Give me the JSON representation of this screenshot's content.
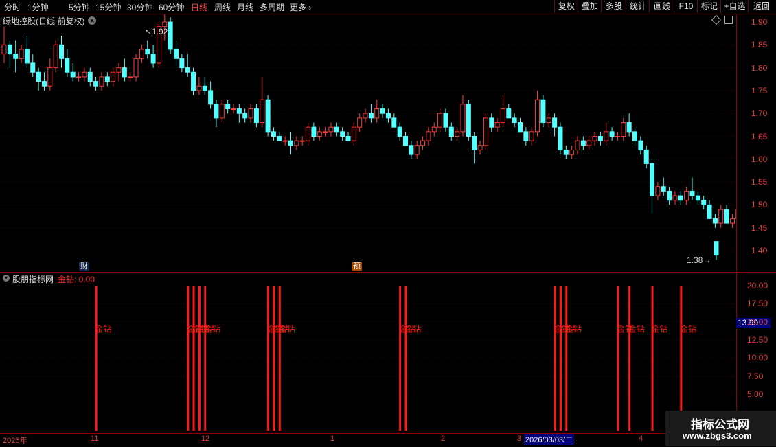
{
  "toolbar": {
    "periods": [
      "分时",
      "1分钟",
      "5分钟",
      "15分钟",
      "30分钟",
      "60分钟",
      "日线",
      "周线",
      "月线",
      "多周期",
      "更多"
    ],
    "active_period": "日线",
    "buttons": [
      "复权",
      "叠加",
      "多股",
      "统计",
      "画线",
      "F10",
      "标记",
      "+自选",
      "返回"
    ]
  },
  "main": {
    "title": "绿地控股(日线 前复权)",
    "high_label": "1.92",
    "low_label": "1.38",
    "badge_cai": "财",
    "badge_yu": "预",
    "yaxis": [
      "1.90",
      "1.85",
      "1.80",
      "1.75",
      "1.70",
      "1.65",
      "1.60",
      "1.55",
      "1.50",
      "1.45",
      "1.40"
    ]
  },
  "indicator": {
    "title": "股朋指标网",
    "series_label": "金钻: 0.00",
    "bar_label": "金钻",
    "current_value": "13.99",
    "yaxis": [
      "20.00",
      "17.50",
      "15.00",
      "12.50",
      "10.00",
      "7.50",
      "5.00"
    ],
    "signal_bar_value": 20
  },
  "dates": {
    "labels": [
      "2025年",
      "11",
      "12",
      "1",
      "2",
      "3",
      "2026/03/03/二",
      "4"
    ]
  },
  "watermark": {
    "line1": "指标公式网",
    "line2": "www.zbgs3.com"
  },
  "colors": {
    "up": "#ff3c3c",
    "down": "#54ffff",
    "axis": "#8b0000",
    "signal": "#ff1a1a",
    "highlight": "#00007a"
  },
  "chart_data": {
    "type": "candlestick",
    "ylim": [
      1.38,
      1.93
    ],
    "candles": [
      {
        "o": 1.83,
        "h": 1.89,
        "l": 1.81,
        "c": 1.85
      },
      {
        "o": 1.85,
        "h": 1.86,
        "l": 1.8,
        "c": 1.83
      },
      {
        "o": 1.83,
        "h": 1.86,
        "l": 1.79,
        "c": 1.82
      },
      {
        "o": 1.82,
        "h": 1.85,
        "l": 1.81,
        "c": 1.84
      },
      {
        "o": 1.84,
        "h": 1.87,
        "l": 1.8,
        "c": 1.81
      },
      {
        "o": 1.81,
        "h": 1.83,
        "l": 1.78,
        "c": 1.79
      },
      {
        "o": 1.79,
        "h": 1.8,
        "l": 1.75,
        "c": 1.77
      },
      {
        "o": 1.77,
        "h": 1.79,
        "l": 1.75,
        "c": 1.76
      },
      {
        "o": 1.76,
        "h": 1.82,
        "l": 1.75,
        "c": 1.8
      },
      {
        "o": 1.8,
        "h": 1.86,
        "l": 1.79,
        "c": 1.85
      },
      {
        "o": 1.85,
        "h": 1.87,
        "l": 1.8,
        "c": 1.82
      },
      {
        "o": 1.82,
        "h": 1.84,
        "l": 1.78,
        "c": 1.79
      },
      {
        "o": 1.79,
        "h": 1.81,
        "l": 1.77,
        "c": 1.78
      },
      {
        "o": 1.78,
        "h": 1.79,
        "l": 1.77,
        "c": 1.78
      },
      {
        "o": 1.78,
        "h": 1.8,
        "l": 1.77,
        "c": 1.79
      },
      {
        "o": 1.79,
        "h": 1.8,
        "l": 1.76,
        "c": 1.77
      },
      {
        "o": 1.77,
        "h": 1.78,
        "l": 1.75,
        "c": 1.76
      },
      {
        "o": 1.76,
        "h": 1.79,
        "l": 1.75,
        "c": 1.78
      },
      {
        "o": 1.78,
        "h": 1.79,
        "l": 1.76,
        "c": 1.77
      },
      {
        "o": 1.77,
        "h": 1.8,
        "l": 1.76,
        "c": 1.79
      },
      {
        "o": 1.79,
        "h": 1.81,
        "l": 1.77,
        "c": 1.8
      },
      {
        "o": 1.8,
        "h": 1.82,
        "l": 1.77,
        "c": 1.78
      },
      {
        "o": 1.78,
        "h": 1.79,
        "l": 1.77,
        "c": 1.78
      },
      {
        "o": 1.78,
        "h": 1.83,
        "l": 1.77,
        "c": 1.82
      },
      {
        "o": 1.82,
        "h": 1.85,
        "l": 1.81,
        "c": 1.84
      },
      {
        "o": 1.84,
        "h": 1.86,
        "l": 1.82,
        "c": 1.83
      },
      {
        "o": 1.83,
        "h": 1.85,
        "l": 1.8,
        "c": 1.81
      },
      {
        "o": 1.81,
        "h": 1.9,
        "l": 1.8,
        "c": 1.89
      },
      {
        "o": 1.89,
        "h": 1.92,
        "l": 1.86,
        "c": 1.9
      },
      {
        "o": 1.9,
        "h": 1.91,
        "l": 1.83,
        "c": 1.84
      },
      {
        "o": 1.84,
        "h": 1.86,
        "l": 1.8,
        "c": 1.82
      },
      {
        "o": 1.82,
        "h": 1.83,
        "l": 1.79,
        "c": 1.8
      },
      {
        "o": 1.8,
        "h": 1.83,
        "l": 1.78,
        "c": 1.79
      },
      {
        "o": 1.79,
        "h": 1.8,
        "l": 1.74,
        "c": 1.75
      },
      {
        "o": 1.75,
        "h": 1.78,
        "l": 1.74,
        "c": 1.76
      },
      {
        "o": 1.76,
        "h": 1.78,
        "l": 1.74,
        "c": 1.75
      },
      {
        "o": 1.75,
        "h": 1.77,
        "l": 1.71,
        "c": 1.72
      },
      {
        "o": 1.72,
        "h": 1.73,
        "l": 1.67,
        "c": 1.69
      },
      {
        "o": 1.69,
        "h": 1.73,
        "l": 1.68,
        "c": 1.72
      },
      {
        "o": 1.72,
        "h": 1.73,
        "l": 1.7,
        "c": 1.71
      },
      {
        "o": 1.71,
        "h": 1.72,
        "l": 1.7,
        "c": 1.71
      },
      {
        "o": 1.71,
        "h": 1.72,
        "l": 1.68,
        "c": 1.7
      },
      {
        "o": 1.7,
        "h": 1.71,
        "l": 1.68,
        "c": 1.69
      },
      {
        "o": 1.69,
        "h": 1.72,
        "l": 1.68,
        "c": 1.71
      },
      {
        "o": 1.71,
        "h": 1.72,
        "l": 1.67,
        "c": 1.68
      },
      {
        "o": 1.68,
        "h": 1.78,
        "l": 1.67,
        "c": 1.73
      },
      {
        "o": 1.73,
        "h": 1.74,
        "l": 1.65,
        "c": 1.66
      },
      {
        "o": 1.66,
        "h": 1.67,
        "l": 1.64,
        "c": 1.65
      },
      {
        "o": 1.65,
        "h": 1.66,
        "l": 1.64,
        "c": 1.64
      },
      {
        "o": 1.64,
        "h": 1.65,
        "l": 1.63,
        "c": 1.64
      },
      {
        "o": 1.64,
        "h": 1.66,
        "l": 1.61,
        "c": 1.63
      },
      {
        "o": 1.63,
        "h": 1.65,
        "l": 1.62,
        "c": 1.64
      },
      {
        "o": 1.64,
        "h": 1.65,
        "l": 1.63,
        "c": 1.64
      },
      {
        "o": 1.64,
        "h": 1.68,
        "l": 1.63,
        "c": 1.67
      },
      {
        "o": 1.67,
        "h": 1.68,
        "l": 1.64,
        "c": 1.65
      },
      {
        "o": 1.65,
        "h": 1.67,
        "l": 1.64,
        "c": 1.66
      },
      {
        "o": 1.66,
        "h": 1.67,
        "l": 1.65,
        "c": 1.66
      },
      {
        "o": 1.66,
        "h": 1.68,
        "l": 1.65,
        "c": 1.67
      },
      {
        "o": 1.67,
        "h": 1.68,
        "l": 1.65,
        "c": 1.66
      },
      {
        "o": 1.66,
        "h": 1.67,
        "l": 1.64,
        "c": 1.65
      },
      {
        "o": 1.65,
        "h": 1.66,
        "l": 1.64,
        "c": 1.64
      },
      {
        "o": 1.64,
        "h": 1.68,
        "l": 1.63,
        "c": 1.67
      },
      {
        "o": 1.67,
        "h": 1.7,
        "l": 1.66,
        "c": 1.69
      },
      {
        "o": 1.69,
        "h": 1.71,
        "l": 1.68,
        "c": 1.7
      },
      {
        "o": 1.7,
        "h": 1.72,
        "l": 1.68,
        "c": 1.69
      },
      {
        "o": 1.69,
        "h": 1.73,
        "l": 1.68,
        "c": 1.71
      },
      {
        "o": 1.71,
        "h": 1.72,
        "l": 1.69,
        "c": 1.7
      },
      {
        "o": 1.7,
        "h": 1.71,
        "l": 1.68,
        "c": 1.69
      },
      {
        "o": 1.69,
        "h": 1.7,
        "l": 1.67,
        "c": 1.67
      },
      {
        "o": 1.67,
        "h": 1.68,
        "l": 1.64,
        "c": 1.65
      },
      {
        "o": 1.65,
        "h": 1.66,
        "l": 1.63,
        "c": 1.63
      },
      {
        "o": 1.63,
        "h": 1.64,
        "l": 1.6,
        "c": 1.61
      },
      {
        "o": 1.61,
        "h": 1.64,
        "l": 1.6,
        "c": 1.63
      },
      {
        "o": 1.63,
        "h": 1.65,
        "l": 1.62,
        "c": 1.64
      },
      {
        "o": 1.64,
        "h": 1.67,
        "l": 1.63,
        "c": 1.66
      },
      {
        "o": 1.66,
        "h": 1.68,
        "l": 1.65,
        "c": 1.67
      },
      {
        "o": 1.67,
        "h": 1.71,
        "l": 1.66,
        "c": 1.7
      },
      {
        "o": 1.7,
        "h": 1.71,
        "l": 1.66,
        "c": 1.67
      },
      {
        "o": 1.67,
        "h": 1.68,
        "l": 1.64,
        "c": 1.65
      },
      {
        "o": 1.65,
        "h": 1.67,
        "l": 1.64,
        "c": 1.66
      },
      {
        "o": 1.66,
        "h": 1.74,
        "l": 1.65,
        "c": 1.72
      },
      {
        "o": 1.72,
        "h": 1.73,
        "l": 1.64,
        "c": 1.65
      },
      {
        "o": 1.65,
        "h": 1.66,
        "l": 1.59,
        "c": 1.62
      },
      {
        "o": 1.62,
        "h": 1.64,
        "l": 1.61,
        "c": 1.63
      },
      {
        "o": 1.63,
        "h": 1.7,
        "l": 1.62,
        "c": 1.69
      },
      {
        "o": 1.69,
        "h": 1.7,
        "l": 1.66,
        "c": 1.67
      },
      {
        "o": 1.67,
        "h": 1.69,
        "l": 1.66,
        "c": 1.68
      },
      {
        "o": 1.68,
        "h": 1.74,
        "l": 1.67,
        "c": 1.71
      },
      {
        "o": 1.71,
        "h": 1.72,
        "l": 1.69,
        "c": 1.69
      },
      {
        "o": 1.69,
        "h": 1.7,
        "l": 1.67,
        "c": 1.68
      },
      {
        "o": 1.68,
        "h": 1.69,
        "l": 1.66,
        "c": 1.66
      },
      {
        "o": 1.66,
        "h": 1.67,
        "l": 1.63,
        "c": 1.64
      },
      {
        "o": 1.64,
        "h": 1.67,
        "l": 1.63,
        "c": 1.66
      },
      {
        "o": 1.66,
        "h": 1.75,
        "l": 1.65,
        "c": 1.73
      },
      {
        "o": 1.73,
        "h": 1.74,
        "l": 1.67,
        "c": 1.68
      },
      {
        "o": 1.68,
        "h": 1.7,
        "l": 1.67,
        "c": 1.69
      },
      {
        "o": 1.69,
        "h": 1.7,
        "l": 1.65,
        "c": 1.67
      },
      {
        "o": 1.67,
        "h": 1.68,
        "l": 1.61,
        "c": 1.62
      },
      {
        "o": 1.62,
        "h": 1.63,
        "l": 1.6,
        "c": 1.61
      },
      {
        "o": 1.61,
        "h": 1.63,
        "l": 1.6,
        "c": 1.62
      },
      {
        "o": 1.62,
        "h": 1.65,
        "l": 1.61,
        "c": 1.64
      },
      {
        "o": 1.64,
        "h": 1.65,
        "l": 1.62,
        "c": 1.63
      },
      {
        "o": 1.63,
        "h": 1.65,
        "l": 1.62,
        "c": 1.64
      },
      {
        "o": 1.64,
        "h": 1.66,
        "l": 1.63,
        "c": 1.65
      },
      {
        "o": 1.65,
        "h": 1.66,
        "l": 1.63,
        "c": 1.64
      },
      {
        "o": 1.64,
        "h": 1.68,
        "l": 1.63,
        "c": 1.66
      },
      {
        "o": 1.66,
        "h": 1.67,
        "l": 1.64,
        "c": 1.65
      },
      {
        "o": 1.65,
        "h": 1.66,
        "l": 1.64,
        "c": 1.65
      },
      {
        "o": 1.65,
        "h": 1.69,
        "l": 1.64,
        "c": 1.68
      },
      {
        "o": 1.68,
        "h": 1.7,
        "l": 1.65,
        "c": 1.66
      },
      {
        "o": 1.66,
        "h": 1.67,
        "l": 1.63,
        "c": 1.64
      },
      {
        "o": 1.64,
        "h": 1.65,
        "l": 1.61,
        "c": 1.62
      },
      {
        "o": 1.62,
        "h": 1.63,
        "l": 1.58,
        "c": 1.59
      },
      {
        "o": 1.59,
        "h": 1.6,
        "l": 1.48,
        "c": 1.52
      },
      {
        "o": 1.52,
        "h": 1.55,
        "l": 1.51,
        "c": 1.54
      },
      {
        "o": 1.54,
        "h": 1.56,
        "l": 1.52,
        "c": 1.53
      },
      {
        "o": 1.53,
        "h": 1.54,
        "l": 1.5,
        "c": 1.51
      },
      {
        "o": 1.51,
        "h": 1.53,
        "l": 1.5,
        "c": 1.52
      },
      {
        "o": 1.52,
        "h": 1.53,
        "l": 1.5,
        "c": 1.51
      },
      {
        "o": 1.51,
        "h": 1.54,
        "l": 1.5,
        "c": 1.53
      },
      {
        "o": 1.53,
        "h": 1.56,
        "l": 1.51,
        "c": 1.52
      },
      {
        "o": 1.52,
        "h": 1.53,
        "l": 1.5,
        "c": 1.51
      },
      {
        "o": 1.51,
        "h": 1.52,
        "l": 1.49,
        "c": 1.5
      },
      {
        "o": 1.5,
        "h": 1.51,
        "l": 1.47,
        "c": 1.47
      },
      {
        "o": 1.47,
        "h": 1.48,
        "l": 1.45,
        "c": 1.46
      },
      {
        "o": 1.46,
        "h": 1.5,
        "l": 1.45,
        "c": 1.49
      },
      {
        "o": 1.49,
        "h": 1.5,
        "l": 1.46,
        "c": 1.46
      },
      {
        "o": 1.46,
        "h": 1.48,
        "l": 1.45,
        "c": 1.47
      },
      {
        "o": 1.47,
        "h": 1.5,
        "l": 1.46,
        "c": 1.49
      },
      {
        "o": 1.49,
        "h": 1.54,
        "l": 1.48,
        "c": 1.53
      },
      {
        "o": 1.53,
        "h": 1.56,
        "l": 1.49,
        "c": 1.5
      },
      {
        "o": 1.5,
        "h": 1.51,
        "l": 1.48,
        "c": 1.49
      },
      {
        "o": 1.49,
        "h": 1.5,
        "l": 1.47,
        "c": 1.48
      },
      {
        "o": 1.48,
        "h": 1.49,
        "l": 1.46,
        "c": 1.47
      },
      {
        "o": 1.47,
        "h": 1.48,
        "l": 1.46,
        "c": 1.47
      },
      {
        "o": 1.42,
        "h": 1.42,
        "l": 1.38,
        "c": 1.39
      }
    ],
    "signals": [
      16,
      32,
      33,
      34,
      35,
      46,
      47,
      48,
      69,
      70,
      96,
      97,
      98,
      107,
      109,
      113,
      118
    ]
  }
}
